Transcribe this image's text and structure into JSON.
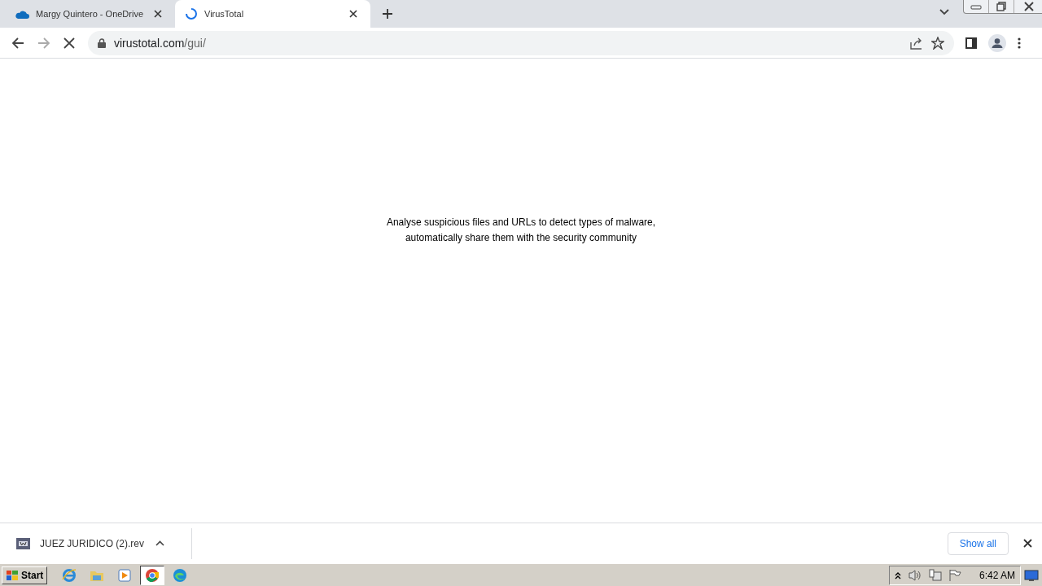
{
  "tabs": [
    {
      "title": "Margy Quintero - OneDrive",
      "selected": false,
      "loading": false
    },
    {
      "title": "VirusTotal",
      "selected": true,
      "loading": true
    }
  ],
  "toolbar": {
    "loading": true,
    "host": "virustotal.com",
    "path": "/gui/"
  },
  "page": {
    "tagline_lines": [
      "Analyse suspicious files and URLs to detect types of malware,",
      "automatically share them with the security community"
    ]
  },
  "downloads": {
    "items": [
      {
        "filename": "JUEZ JURIDICO (2).rev"
      }
    ],
    "show_all": "Show all"
  },
  "taskbar": {
    "start": "Start",
    "apps": [
      {
        "kind": "ie",
        "active": false
      },
      {
        "kind": "folder",
        "active": false
      },
      {
        "kind": "media",
        "active": false
      },
      {
        "kind": "chrome",
        "active": true
      },
      {
        "kind": "edge",
        "active": false
      }
    ],
    "clock": "6:42 AM"
  }
}
